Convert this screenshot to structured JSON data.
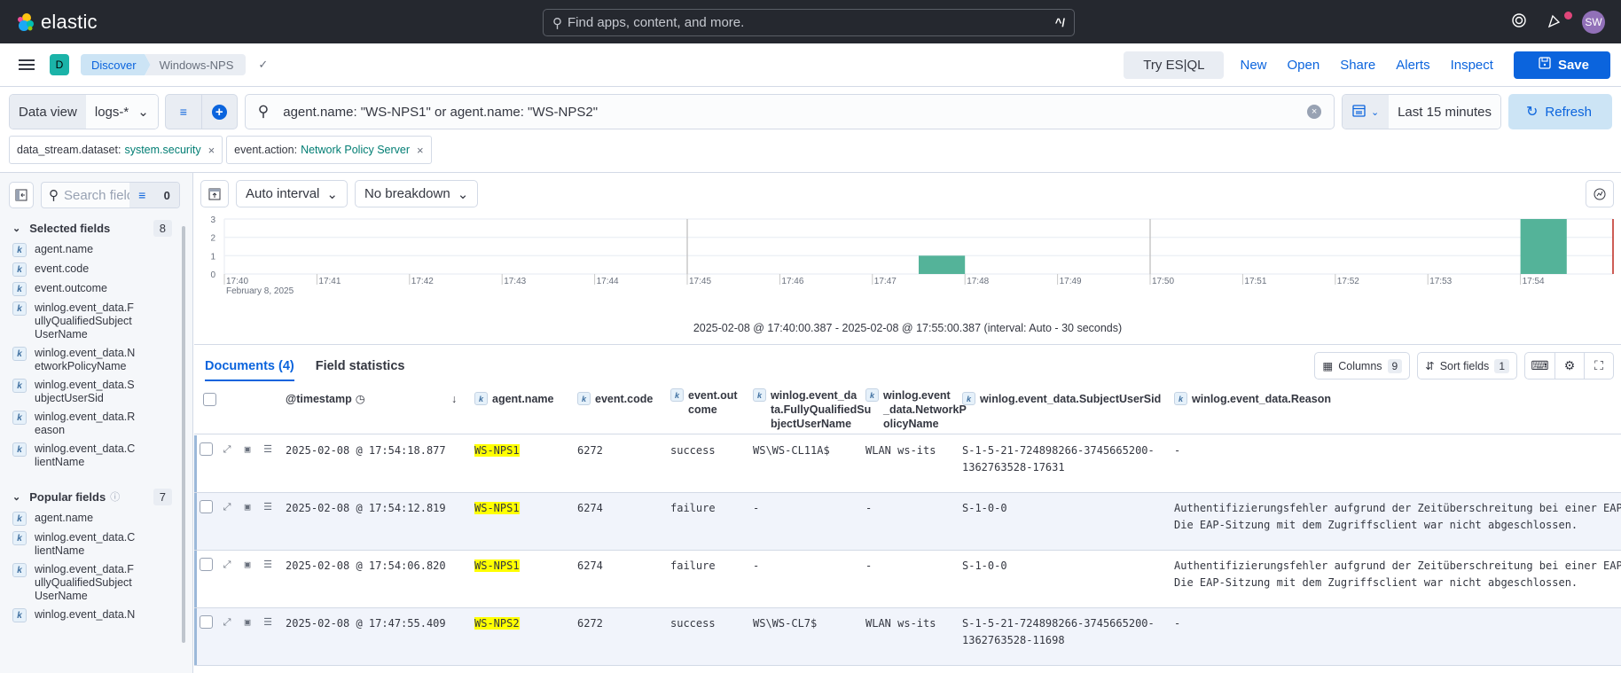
{
  "topbar": {
    "brand": "elastic",
    "search_placeholder": "Find apps, content, and more.",
    "search_shortcut": "^/",
    "avatar_initials": "SW",
    "colors": {
      "bg": "#25282f",
      "avatar": "#9170b8",
      "notification": "#e0467a"
    }
  },
  "subbar": {
    "space_initial": "D",
    "breadcrumbs": [
      "Discover",
      "Windows-NPS"
    ],
    "menu": {
      "try_esql": "Try ES|QL",
      "new": "New",
      "open": "Open",
      "share": "Share",
      "alerts": "Alerts",
      "inspect": "Inspect",
      "save": "Save"
    }
  },
  "querybar": {
    "data_view_label": "Data view",
    "data_view_value": "logs-*",
    "query": "agent.name: \"WS-NPS1\" or agent.name: \"WS-NPS2\"",
    "time_range": "Last 15 minutes",
    "refresh_label": "Refresh"
  },
  "filters": [
    {
      "field": "data_stream.dataset:",
      "value": "system.security"
    },
    {
      "field": "event.action:",
      "value": "Network Policy Server"
    }
  ],
  "sidebar": {
    "search_placeholder": "Search field names",
    "filter_count": "0",
    "selected_title": "Selected fields",
    "selected_count": "8",
    "selected_fields": [
      "agent.name",
      "event.code",
      "event.outcome",
      "winlog.event_data.FullyQualifiedSubjectUserName",
      "winlog.event_data.NetworkPolicyName",
      "winlog.event_data.SubjectUserSid",
      "winlog.event_data.Reason",
      "winlog.event_data.ClientName"
    ],
    "popular_title": "Popular fields",
    "popular_count": "7",
    "popular_fields": [
      "agent.name",
      "winlog.event_data.ClientName",
      "winlog.event_data.FullyQualifiedSubjectUserName",
      "winlog.event_data.N"
    ]
  },
  "chart_controls": {
    "interval": "Auto interval",
    "breakdown": "No breakdown"
  },
  "chart_data": {
    "type": "bar",
    "title": "",
    "xlabel": "February 8, 2025",
    "ylabel": "",
    "ylim": [
      0,
      3
    ],
    "yticks": [
      "0",
      "1",
      "2",
      "3"
    ],
    "xticks": [
      "17:40",
      "17:41",
      "17:42",
      "17:43",
      "17:44",
      "17:45",
      "17:46",
      "17:47",
      "17:48",
      "17:49",
      "17:50",
      "17:51",
      "17:52",
      "17:53",
      "17:54"
    ],
    "x_domain_minutes": [
      0,
      15.0
    ],
    "interval_minutes": 0.5,
    "bars": [
      {
        "start": "17:47:30",
        "start_min": 7.5,
        "value": 1
      },
      {
        "start": "17:54:00",
        "start_min": 14.0,
        "value": 3
      }
    ],
    "grid": true,
    "bar_color": "#54b399",
    "now_marker_color": "#bd271e"
  },
  "chart_range_text": "2025-02-08 @ 17:40:00.387 - 2025-02-08 @ 17:55:00.387 (interval: Auto - 30 seconds)",
  "documents": {
    "tab_documents": "Documents (4)",
    "tab_field_stats": "Field statistics",
    "columns_label": "Columns",
    "columns_count": "9",
    "sort_label": "Sort fields",
    "sort_count": "1",
    "headers": [
      "@timestamp",
      "agent.name",
      "event.code",
      "event.out come",
      "winlog.event_da ta.FullyQualifiedSu bjectUserName",
      "winlog.event _data.NetworkP olicyName",
      "winlog.event_data.SubjectUserSid",
      "winlog.event_data.Reason"
    ],
    "rows": [
      {
        "timestamp": "2025-02-08 @ 17:54:18.877",
        "agent": "WS-NPS1",
        "code": "6272",
        "outcome": "success",
        "fqsun": "WS\\WS-CL11A$",
        "policy": "WLAN ws-its",
        "sid": "S-1-5-21-724898266-3745665200-\n1362763528-17631",
        "reason": "-"
      },
      {
        "timestamp": "2025-02-08 @ 17:54:12.819",
        "agent": "WS-NPS1",
        "code": "6274",
        "outcome": "failure",
        "fqsun": "-",
        "policy": "-",
        "sid": "S-1-0-0",
        "reason": "Authentifizierungsfehler aufgrund der Zeitüberschreitung bei einer EAP\nDie EAP-Sitzung mit dem Zugriffsclient war nicht abgeschlossen."
      },
      {
        "timestamp": "2025-02-08 @ 17:54:06.820",
        "agent": "WS-NPS1",
        "code": "6274",
        "outcome": "failure",
        "fqsun": "-",
        "policy": "-",
        "sid": "S-1-0-0",
        "reason": "Authentifizierungsfehler aufgrund der Zeitüberschreitung bei einer EAP\nDie EAP-Sitzung mit dem Zugriffsclient war nicht abgeschlossen."
      },
      {
        "timestamp": "2025-02-08 @ 17:47:55.409",
        "agent": "WS-NPS2",
        "code": "6272",
        "outcome": "success",
        "fqsun": "WS\\WS-CL7$",
        "policy": "WLAN ws-its",
        "sid": "S-1-5-21-724898266-3745665200-\n1362763528-11698",
        "reason": "-"
      }
    ]
  }
}
